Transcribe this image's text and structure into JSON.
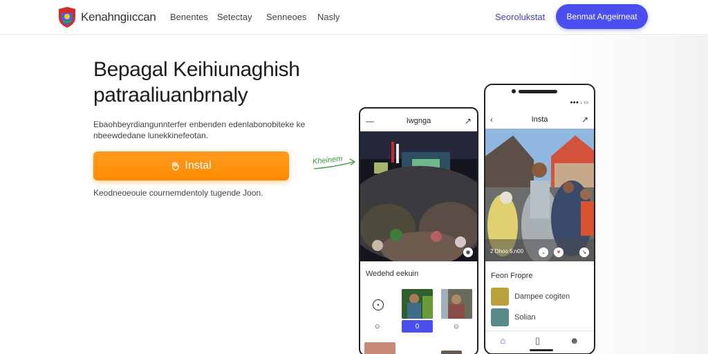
{
  "nav": {
    "brand": "Kenahngiıccan",
    "links": [
      "Benentes",
      "Setectay",
      "Senneoes",
      "Nasly"
    ],
    "signin": "Seorolukstat",
    "cta": "Benmat Angeirneat"
  },
  "hero": {
    "title_line1": "Bepagal Keihiunaghish",
    "title_line2": "patraaliuanbrnaly",
    "description_line1": "Ebaohbeyrdiangunnterfer enbenden edenlabonobiteke ke",
    "description_line2": "nbeewdedane lunekkinefeotan.",
    "install_label": "Instal",
    "note": "Keodneoeouie cournemdentoly tugende Joon.",
    "annotation": "Kheinem"
  },
  "phone1": {
    "title": "Iwgnga",
    "section_label": "Wedehd eekuin",
    "stats": [
      "⊙",
      "0",
      "⊙"
    ],
    "selected_index": 1
  },
  "phone2": {
    "status": "●●● ↓ ▭",
    "title": "Insta",
    "photo_caption": "2 Dhoo 5:n00",
    "section_label": "Feon Fropre",
    "items": [
      "Dampee cogiten",
      "Solian"
    ]
  },
  "colors": {
    "accent": "#4b4ff0",
    "install": "#ff8a00",
    "link": "#3b3fc4"
  },
  "icons": [
    "shield-logo-icon",
    "hand-icon",
    "menu-icon",
    "share-icon",
    "back-icon",
    "play-icon",
    "heart-icon",
    "chevron-down-icon",
    "home-icon",
    "phone-icon",
    "user-icon"
  ]
}
